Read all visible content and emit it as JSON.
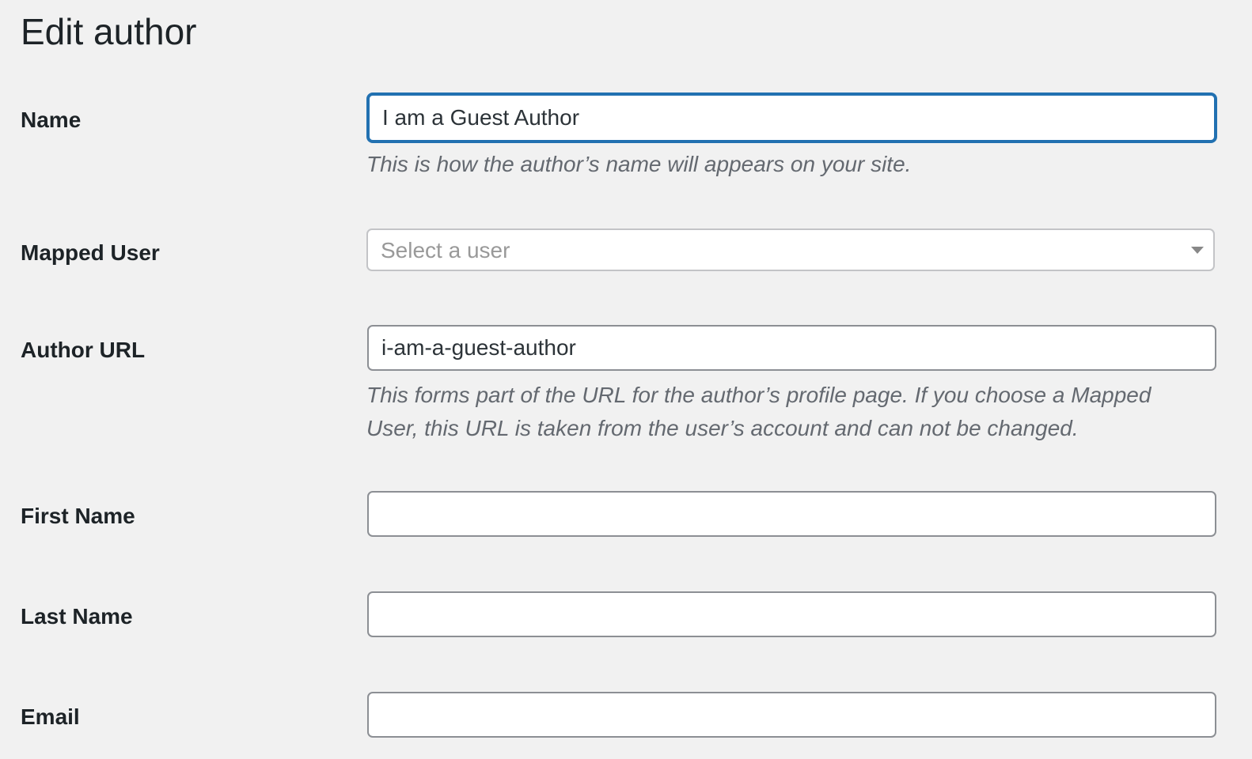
{
  "page": {
    "title": "Edit author"
  },
  "fields": {
    "name": {
      "label": "Name",
      "value": "I am a Guest Author",
      "description": "This is how the author’s name will appears on your site."
    },
    "mapped_user": {
      "label": "Mapped User",
      "placeholder": "Select a user",
      "icon": "chevron-down-icon"
    },
    "author_url": {
      "label": "Author URL",
      "value": "i-am-a-guest-author",
      "description_line1": "This forms part of the URL for the author’s profile page. If you choose a Mapped",
      "description_line2": "User, this URL is taken from the user’s account and can not be changed."
    },
    "first_name": {
      "label": "First Name",
      "value": ""
    },
    "last_name": {
      "label": "Last Name",
      "value": ""
    },
    "email": {
      "label": "Email",
      "value": ""
    }
  },
  "colors": {
    "background": "#f1f1f1",
    "focus_border": "#2271b1",
    "input_border": "#8c8f94",
    "description_text": "#646970"
  }
}
